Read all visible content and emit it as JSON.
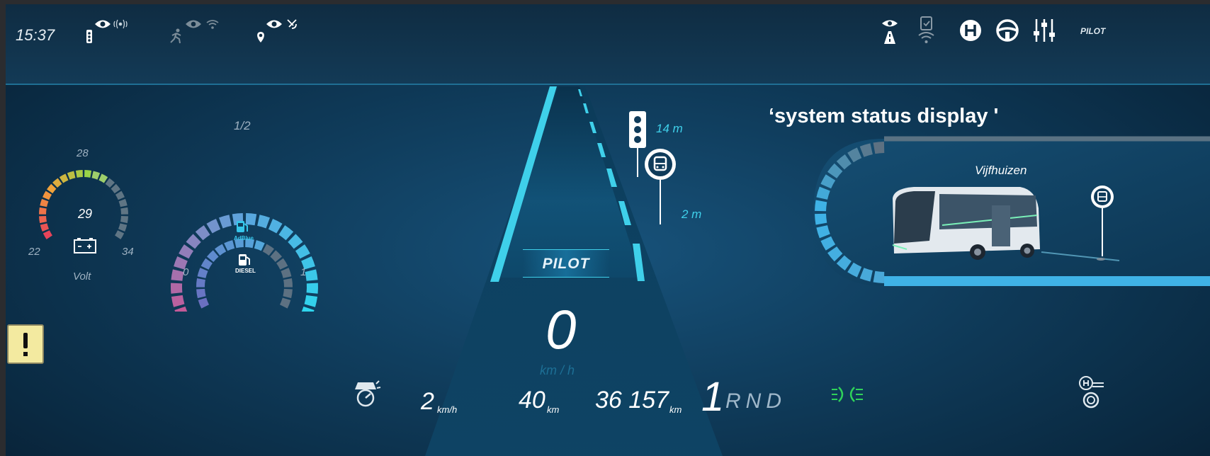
{
  "status_bar": {
    "time": "15:37",
    "right_label": "PILOT"
  },
  "volt_gauge": {
    "value": "29",
    "top_label": "28",
    "min_label": "22",
    "max_label": "34",
    "unit": "Volt"
  },
  "fuel_gauge": {
    "top_label": "1/2",
    "min_label": "0",
    "max_label": "1",
    "adblue_label": "AdBlue",
    "diesel_label": "DIESEL"
  },
  "road": {
    "mode_label": "PILOT",
    "traffic_light_distance": "14 m",
    "bus_stop_distance": "2 m"
  },
  "speed": {
    "value": "0",
    "unit": "km / h"
  },
  "bottom_bar": {
    "limit_value": "2",
    "limit_unit": "km/h",
    "trip_value": "40",
    "trip_unit": "km",
    "odometer_value": "36 157",
    "odometer_unit": "km",
    "gear_current": "1",
    "gear_rest": "RND"
  },
  "annotation": "‘system status display '",
  "route_panel": {
    "destination": "Vijfhuizen"
  },
  "colors": {
    "accent": "#3fd0ea",
    "warning": "#f3eaa0",
    "lights_green": "#2fd15a"
  },
  "icons": {
    "status_left": [
      "traffic-light-camera-icon",
      "pedestrian-camera-icon",
      "location-camera-icon"
    ],
    "status_right": [
      "road-camera-icon",
      "phone-wifi-icon",
      "hold-icon",
      "steering-wheel-icon",
      "sliders-icon"
    ],
    "bottom": [
      "speed-limiter-icon",
      "position-lights-icon",
      "parking-brake-icon"
    ],
    "left": [
      "warning-icon"
    ]
  }
}
